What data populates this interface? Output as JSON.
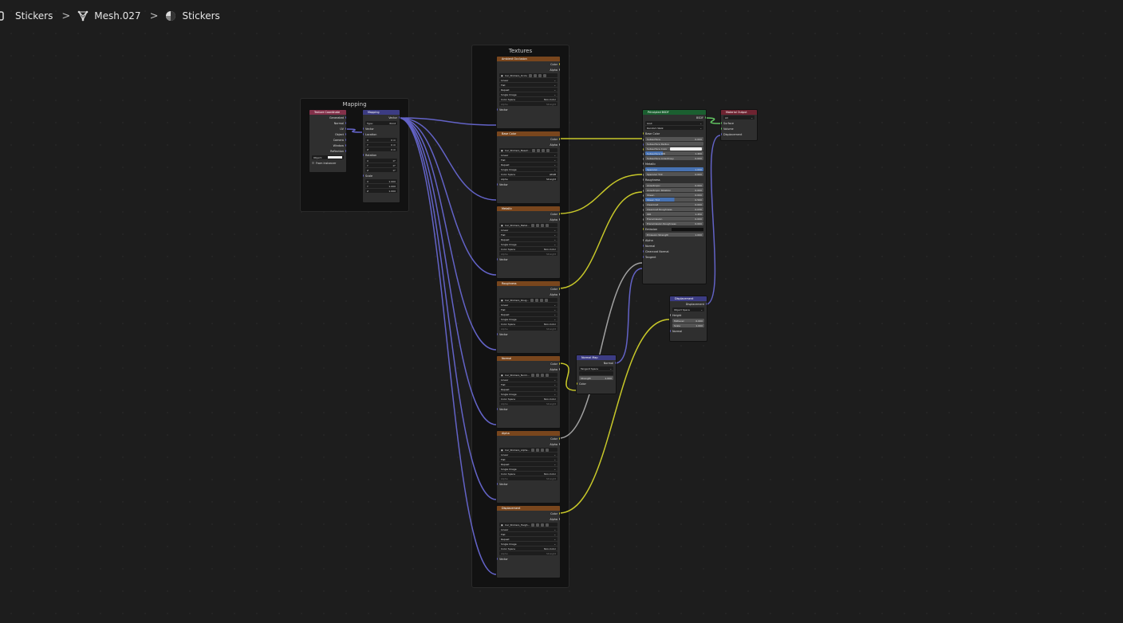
{
  "breadcrumb": {
    "item1": "Stickers",
    "item2": "Mesh.027",
    "item3": "Stickers",
    "sep": ">"
  },
  "frames": {
    "mapping": "Mapping",
    "textures": "Textures"
  },
  "texcoord": {
    "title": "Texture Coordinate",
    "outputs": [
      "Generated",
      "Normal",
      "UV",
      "Object",
      "Camera",
      "Window",
      "Reflection"
    ],
    "object_label": "Object:",
    "from_instancer": "From Instancer"
  },
  "mapping": {
    "title": "Mapping",
    "out": "Vector",
    "type_label": "Type:",
    "type_value": "Point",
    "vector": "Vector",
    "location": "Location",
    "loc": [
      [
        "X",
        "0 m"
      ],
      [
        "Y",
        "0 m"
      ],
      [
        "Z",
        "0 m"
      ]
    ],
    "rotation": "Rotation",
    "rot": [
      [
        "X",
        "0°"
      ],
      [
        "Y",
        "0°"
      ],
      [
        "Z",
        "0°"
      ]
    ],
    "scale": "Scale",
    "scl": [
      [
        "X",
        "1.000"
      ],
      [
        "Y",
        "1.000"
      ],
      [
        "Z",
        "1.000"
      ]
    ]
  },
  "image_common": {
    "color": "Color",
    "alpha": "Alpha",
    "interp": "Linear",
    "proj": "Flat",
    "ext": "Repeat",
    "src": "Single Image",
    "cs_label": "Color Space",
    "alpha_label": "Alpha",
    "vector": "Vector"
  },
  "textures": [
    {
      "title": "Ambient Occlusion",
      "file": "Car_Stickers_Occlu",
      "cs": "Non-Color",
      "alpha": "Straight"
    },
    {
      "title": "Base Color",
      "file": "Car_Stickers_BaseC...",
      "cs": "sRGB",
      "alpha": "Straight"
    },
    {
      "title": "Metallic",
      "file": "Car_Stickers_Metal...",
      "cs": "Non-Color",
      "alpha": "Straight"
    },
    {
      "title": "Roughness",
      "file": "Car_Stickers_Roug...",
      "cs": "Non-Color",
      "alpha": "Straight"
    },
    {
      "title": "Normal",
      "file": "Car_Stickers_Norm...",
      "cs": "Non-Color",
      "alpha": "Straight"
    },
    {
      "title": "Alpha",
      "file": "Car_Stickers_Alpha...",
      "cs": "Non-Color",
      "alpha": "Straight"
    },
    {
      "title": "Displacement",
      "file": "Car_Stickers_Heigh...",
      "cs": "Non-Color",
      "alpha": "Straight"
    }
  ],
  "bsdf": {
    "title": "Principled BSDF",
    "out": "BSDF",
    "dist": "GGX",
    "sss": "Random Walk",
    "base_color": "Base Color",
    "sliders": [
      [
        "Subsurface",
        "0.000",
        0
      ],
      [
        "Subsurface Radius",
        "",
        0
      ],
      [
        "Subsurface Color",
        "",
        0
      ],
      [
        "Subsurface IOR",
        "1.400",
        0.3
      ],
      [
        "Subsurface Anisotropy",
        "0.000",
        0
      ]
    ],
    "metallic": "Metallic",
    "specs": [
      [
        "Specular",
        "1.000",
        1
      ],
      [
        "Specular Tint",
        "0.000",
        0
      ]
    ],
    "roughness": "Roughness",
    "more": [
      [
        "Anisotropic",
        "0.000",
        0
      ],
      [
        "Anisotropic Rotation",
        "0.000",
        0
      ],
      [
        "Sheen",
        "0.000",
        0
      ],
      [
        "Sheen Tint",
        "0.500",
        0.5
      ],
      [
        "Clearcoat",
        "0.000",
        0
      ],
      [
        "Clearcoat Roughness",
        "0.030",
        0
      ],
      [
        "IOR",
        "1.450",
        0
      ],
      [
        "Transmission",
        "0.000",
        0
      ],
      [
        "Transmission Roughness",
        "0.000",
        0
      ]
    ],
    "emission": "Emission",
    "emission_strength": [
      "Emission Strength",
      "1.000"
    ],
    "tail": [
      "Alpha",
      "Normal",
      "Clearcoat Normal",
      "Tangent"
    ]
  },
  "output": {
    "title": "Material Output",
    "target": "All",
    "inputs": [
      "Surface",
      "Volume",
      "Displacement"
    ]
  },
  "normalmap": {
    "title": "Normal Map",
    "out": "Normal",
    "space": "Tangent Space",
    "strength": [
      "Strength",
      "1.000"
    ],
    "color": "Color"
  },
  "displacement": {
    "title": "Displacement",
    "out": "Displacement",
    "space": "Object Space",
    "height": "Height",
    "midlevel": [
      "Midlevel",
      "0.000"
    ],
    "scale": [
      "Scale",
      "1.000"
    ],
    "normal": "Normal"
  },
  "colors": {
    "yellow": "#c7c729",
    "purple": "#6363c7",
    "gray": "#a1a1a1",
    "green": "#63c763"
  }
}
